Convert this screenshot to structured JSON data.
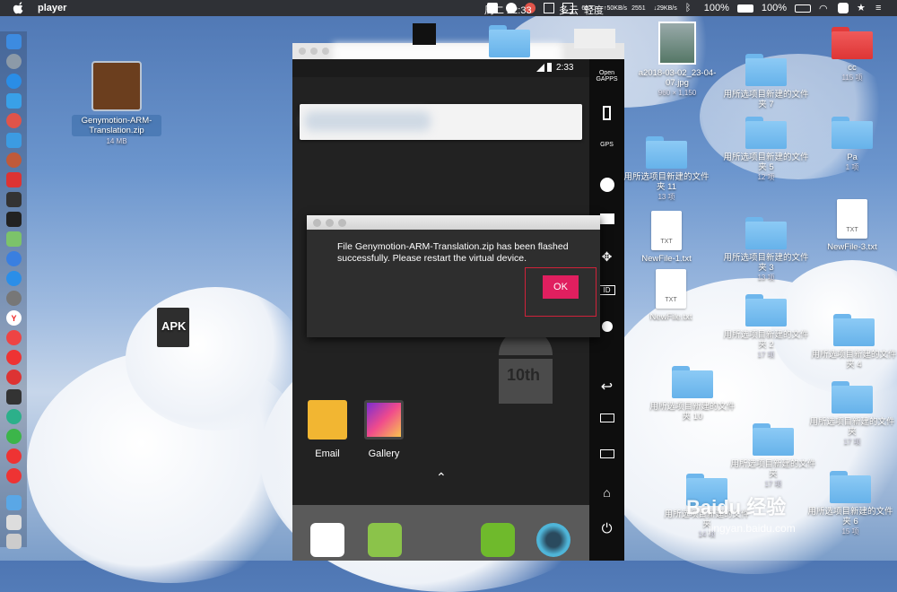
{
  "menubar": {
    "app_name": "player",
    "net_up": "↑50KB/s",
    "net_down": "↓29KB/s",
    "temp": "69℃",
    "rpm": "2551",
    "datetime": "周二 22:33",
    "weather": "多云",
    "air": "轻度",
    "battery1": "100%",
    "battery2": "100%"
  },
  "desktop": {
    "zip_name": "Genymotion-ARM-Translation.zip",
    "zip_size": "14 MB",
    "apk_label": "APK",
    "jpg_name": "a2018-03-02_23-04-07.jpg",
    "jpg_size": "960 × 1,150",
    "items": [
      {
        "label": "cc",
        "sub": "115 项"
      },
      {
        "label": "用所选项目新建的文件夹 7",
        "sub": ""
      },
      {
        "label": "用所选项目新建的文件夹 5",
        "sub": "12 项"
      },
      {
        "label": "Pa",
        "sub": "1 项"
      },
      {
        "label": "用所选项目新建的文件夹 11",
        "sub": "13 项"
      },
      {
        "label": "NewFile-1.txt",
        "sub": ""
      },
      {
        "label": "用所选项目新建的文件夹 3",
        "sub": "13 项"
      },
      {
        "label": "NewFile-3.txt",
        "sub": ""
      },
      {
        "label": "NewFile.txt",
        "sub": ""
      },
      {
        "label": "用所选项目新建的文件夹 2",
        "sub": "17 项"
      },
      {
        "label": "用所选项目新建的文件夹 4",
        "sub": ""
      },
      {
        "label": "用所选项目新建的文件夹 10",
        "sub": ""
      },
      {
        "label": "用所选项目新建的文件夹",
        "sub": "17 项"
      },
      {
        "label": "用所选项目新建的文件夹",
        "sub": ""
      },
      {
        "label": "用所选项目新建的文件夹",
        "sub": "14 项"
      },
      {
        "label": "用所选项目新建的文件夹 6",
        "sub": "15 项"
      }
    ]
  },
  "emulator": {
    "time": "2:33",
    "sidebar": {
      "open_gapps": "Open\nGAPPS",
      "gps": "GPS",
      "id": "ID"
    },
    "dialog": {
      "message": "File Genymotion-ARM-Translation.zip has been flashed successfully. Please restart the virtual device.",
      "ok": "OK"
    },
    "apps": {
      "email": "Email",
      "gallery": "Gallery"
    },
    "version_badge": "10th"
  },
  "watermark": {
    "brand": "Baidu 经验",
    "url": "jingyan.baidu.com"
  }
}
